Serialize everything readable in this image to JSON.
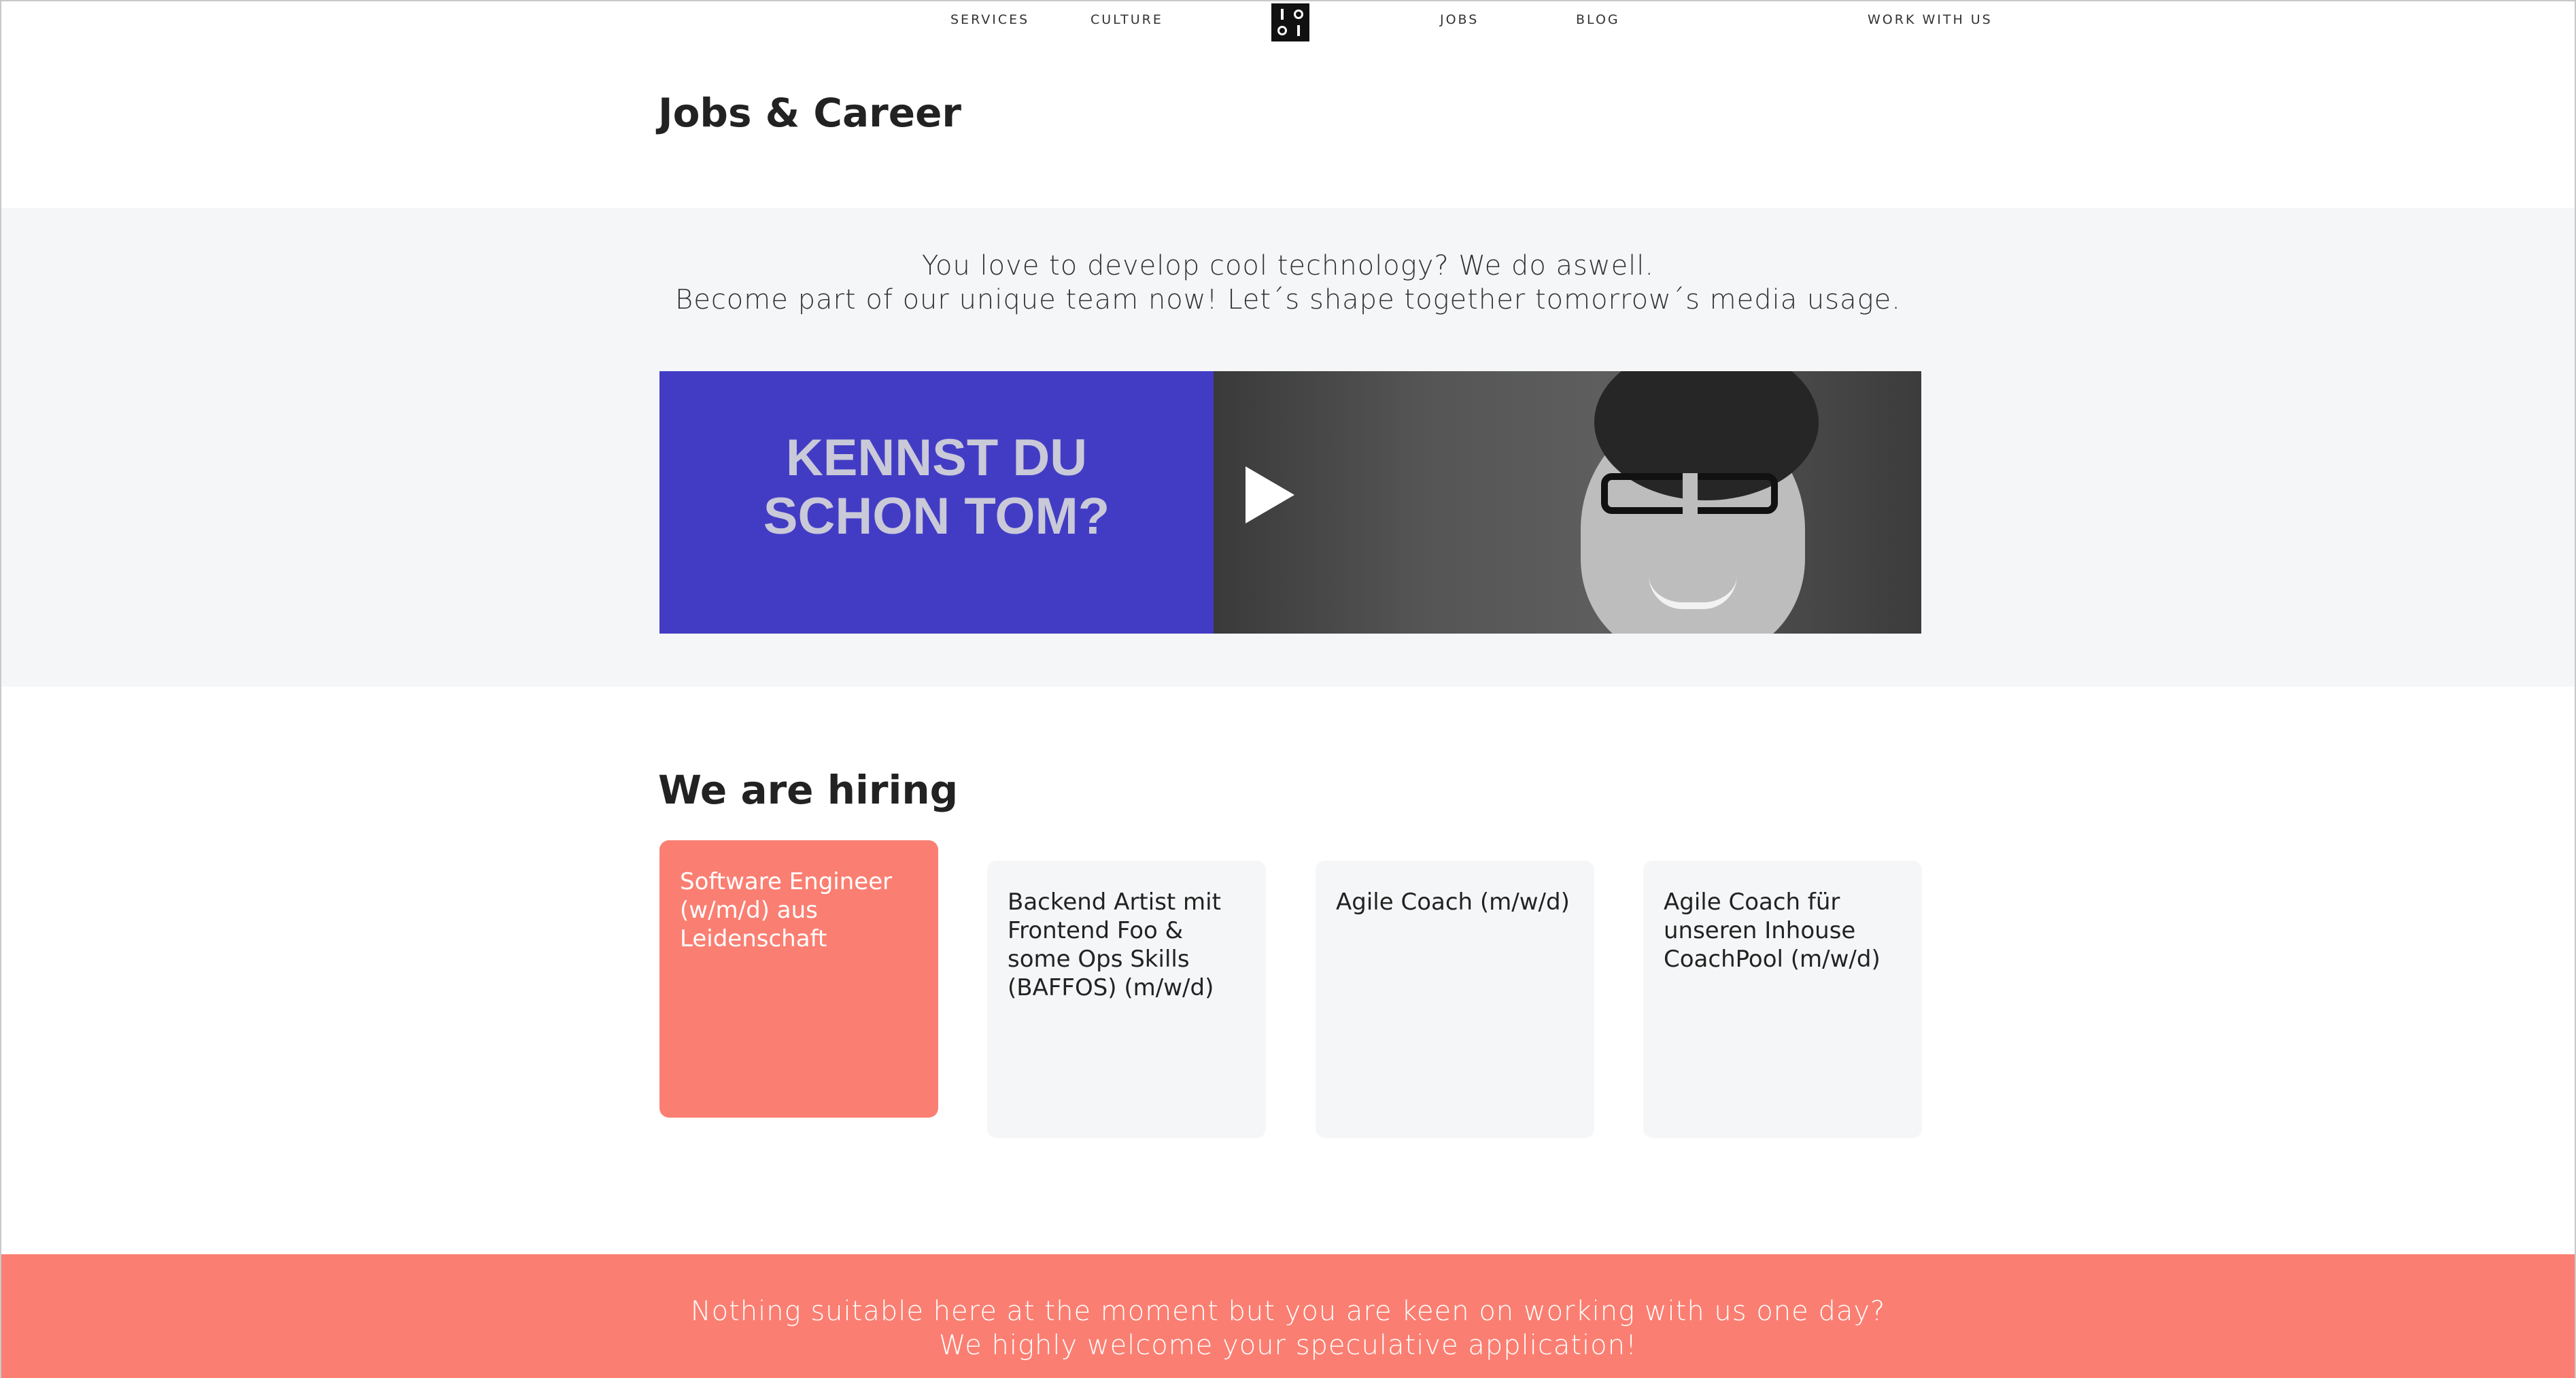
{
  "nav": {
    "services": "SERVICES",
    "culture": "CULTURE",
    "jobs": "JOBS",
    "blog": "BLOG",
    "work_with_us": "WORK WITH US"
  },
  "page": {
    "title": "Jobs & Career"
  },
  "intro": {
    "line1": "You love to develop cool technology? We do aswell.",
    "line2": "Become part of our unique team now! Let´s shape together tomorrow´s media usage."
  },
  "video": {
    "headline": "KENNST DU SCHON TOM?",
    "play_icon": "play-icon",
    "panel_color": "#423cc5"
  },
  "hiring": {
    "title": "We are hiring",
    "jobs": [
      {
        "title": "Software Engineer (w/m/d) aus Leidenschaft",
        "active": true
      },
      {
        "title": "Backend Artist mit Frontend Foo & some Ops Skills (BAFFOS) (m/w/d)",
        "active": false
      },
      {
        "title": "Agile Coach (m/w/d)",
        "active": false
      },
      {
        "title": "Agile Coach für unseren Inhouse CoachPool (m/w/d)",
        "active": false
      }
    ]
  },
  "footer": {
    "line1": "Nothing suitable here at the moment but you are keen on working with us one day?",
    "line2": "We highly welcome your speculative application!"
  },
  "colors": {
    "accent": "#fa7f72",
    "band_background": "#f5f6f7",
    "text": "#222222"
  }
}
